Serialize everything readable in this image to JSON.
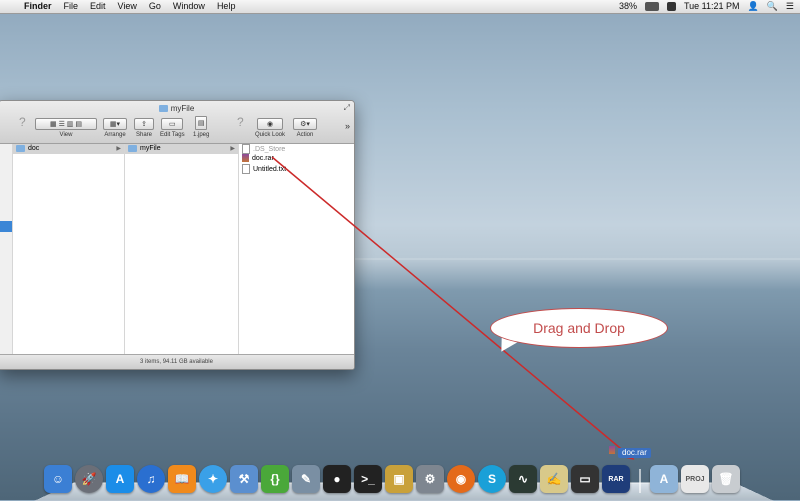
{
  "menubar": {
    "app": "Finder",
    "items": [
      "File",
      "Edit",
      "View",
      "Go",
      "Window",
      "Help"
    ],
    "battery": "38%",
    "clock": "Tue 11:21 PM",
    "status_icons": [
      "cloud-icon",
      "camera-icon",
      "display-icon",
      "clock-icon",
      "sync-icon",
      "bluetooth-icon",
      "wifi-icon",
      "volume-icon",
      "battery-icon",
      "input-flag-icon",
      "user-icon",
      "spotlight-icon",
      "notification-icon"
    ]
  },
  "finder": {
    "title": "myFile",
    "toolbar": {
      "view_label": "View",
      "arrange_label": "Arrange",
      "share_label": "Share",
      "edit_tags_label": "Edit Tags",
      "file_label": "1.jpeg",
      "quick_look_label": "Quick Look",
      "action_label": "Action"
    },
    "column1": [
      {
        "name": "doc"
      }
    ],
    "column2": [
      {
        "name": "myFile"
      }
    ],
    "column3": [
      {
        "name": ".DS_Store"
      },
      {
        "name": "doc.rar"
      },
      {
        "name": "Untitled.txt"
      }
    ],
    "status": "3 items, 94.11 GB available"
  },
  "callout": {
    "text": "Drag and Drop"
  },
  "drag": {
    "label": "doc.rar"
  },
  "dock": {
    "apps": [
      {
        "name": "finder-icon",
        "glyph": "☺",
        "color": "#3b7fd4"
      },
      {
        "name": "launchpad-icon",
        "glyph": "🚀",
        "color": "#6b6f78"
      },
      {
        "name": "app-store-icon",
        "glyph": "A",
        "color": "#1b8de8"
      },
      {
        "name": "itunes-icon",
        "glyph": "♫",
        "color": "#2a6fd0"
      },
      {
        "name": "ibooks-icon",
        "glyph": "📖",
        "color": "#f08a1c"
      },
      {
        "name": "safari-icon",
        "glyph": "✦",
        "color": "#3aa0e8"
      },
      {
        "name": "xcode-icon",
        "glyph": "⚒",
        "color": "#5b8fcf"
      },
      {
        "name": "brackets-icon",
        "glyph": "{}",
        "color": "#4aa83a"
      },
      {
        "name": "preview-icon",
        "glyph": "✎",
        "color": "#7a8fa3"
      },
      {
        "name": "qq-icon",
        "glyph": "●",
        "color": "#222222"
      },
      {
        "name": "terminal-icon",
        "glyph": ">_",
        "color": "#222222"
      },
      {
        "name": "archive-utility-icon",
        "glyph": "▣",
        "color": "#c9a13a"
      },
      {
        "name": "system-preferences-icon",
        "glyph": "⚙",
        "color": "#7e8690"
      },
      {
        "name": "firefox-icon",
        "glyph": "◉",
        "color": "#e46a1a"
      },
      {
        "name": "sync-app-icon",
        "glyph": "S",
        "color": "#1aa0d8"
      },
      {
        "name": "activity-monitor-icon",
        "glyph": "∿",
        "color": "#2b3a33"
      },
      {
        "name": "script-editor-icon",
        "glyph": "✍",
        "color": "#d8c98a"
      },
      {
        "name": "monitor-app-icon",
        "glyph": "▭",
        "color": "#333333"
      },
      {
        "name": "rar-app-icon",
        "glyph": "RAR",
        "color": "#1f3d7a"
      }
    ],
    "right": [
      {
        "name": "applications-folder-icon",
        "glyph": "A",
        "color": "#8fb4d8"
      },
      {
        "name": "document-icon",
        "glyph": "PROJ",
        "color": "#e8e8e8"
      },
      {
        "name": "trash-icon",
        "glyph": "🗑",
        "color": "#c8ccd0"
      }
    ]
  }
}
